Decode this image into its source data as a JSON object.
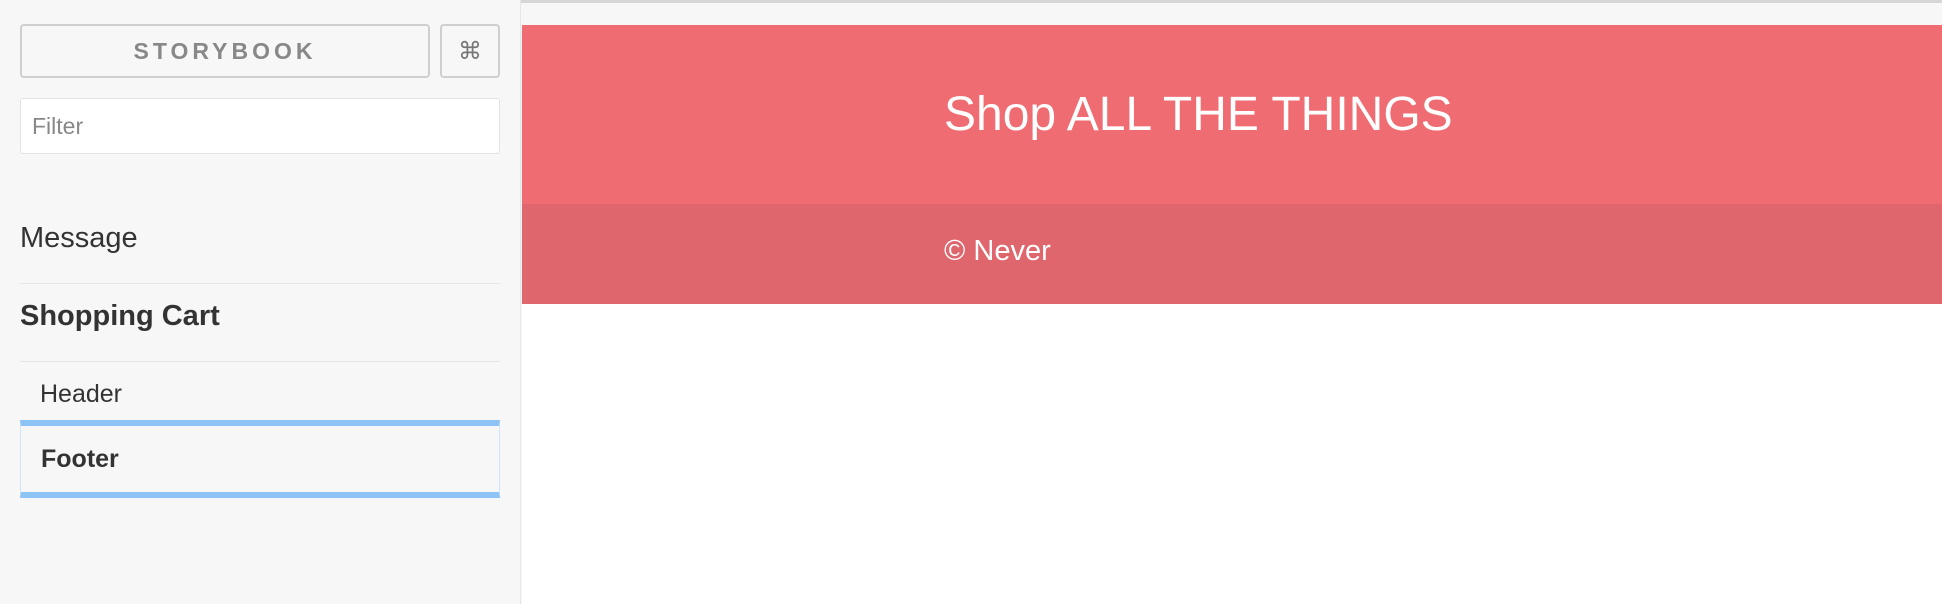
{
  "sidebar": {
    "brand_label": "STORYBOOK",
    "shortcut_label": "⌘",
    "filter": {
      "placeholder": "Filter",
      "value": ""
    },
    "kinds": [
      {
        "label": "Message",
        "selected": false
      },
      {
        "label": "Shopping Cart",
        "selected": true,
        "stories": [
          {
            "label": "Header",
            "selected": false
          },
          {
            "label": "Footer",
            "selected": true
          }
        ]
      }
    ]
  },
  "preview": {
    "title": "Shop ALL THE THINGS",
    "footer_text": "© Never"
  },
  "colors": {
    "header_bg": "#ef6c72",
    "footer_bg": "#df666d",
    "selection_border": "#8ec3f5",
    "sidebar_bg": "#f7f7f7"
  }
}
